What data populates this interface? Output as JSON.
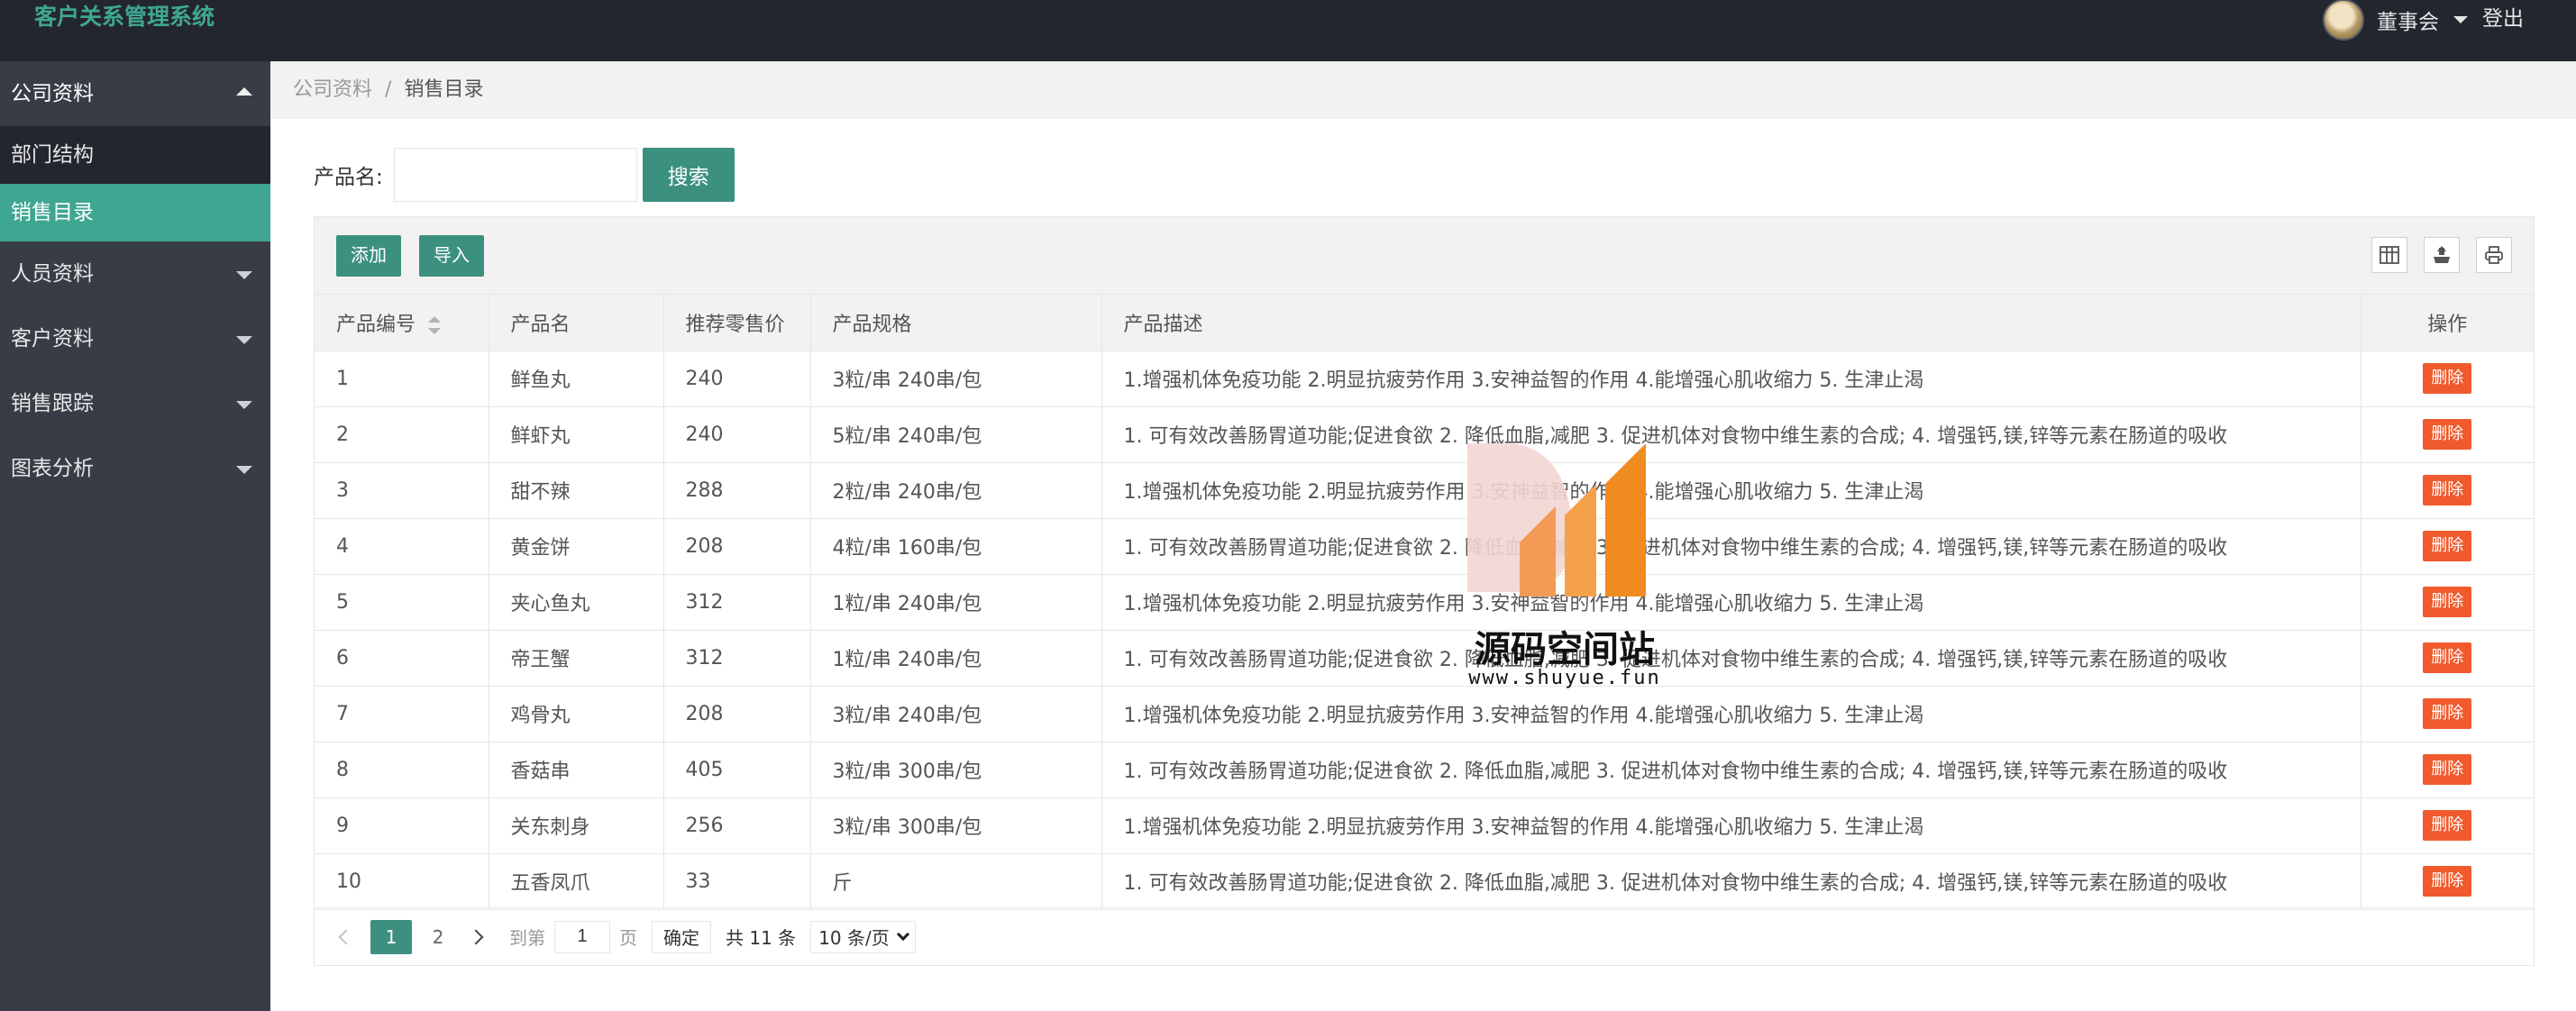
{
  "app": {
    "title": "客户关系管理系统"
  },
  "header": {
    "user_name": "董事会",
    "logout": "登出"
  },
  "sidebar": {
    "items": [
      {
        "label": "公司资料",
        "open": true,
        "children": [
          {
            "label": "部门结构"
          },
          {
            "label": "销售目录",
            "active": true
          }
        ]
      },
      {
        "label": "人员资料"
      },
      {
        "label": "客户资料"
      },
      {
        "label": "销售跟踪"
      },
      {
        "label": "图表分析"
      }
    ]
  },
  "breadcrumb": {
    "parent": "公司资料",
    "separator": "/",
    "current": "销售目录"
  },
  "search": {
    "label": "产品名:",
    "value": "",
    "placeholder": "",
    "button": "搜索"
  },
  "toolbar": {
    "add": "添加",
    "import": "导入"
  },
  "table": {
    "columns": [
      "产品编号",
      "产品名",
      "推荐零售价",
      "产品规格",
      "产品描述",
      "操作"
    ],
    "delete_label": "删除",
    "rows": [
      {
        "id": "1",
        "name": "鲜鱼丸",
        "price": "240",
        "spec": "3粒/串 240串/包",
        "desc": "1.增强机体免疫功能 2.明显抗疲劳作用 3.安神益智的作用 4.能增强心肌收缩力 5. 生津止渴"
      },
      {
        "id": "2",
        "name": "鲜虾丸",
        "price": "240",
        "spec": "5粒/串 240串/包",
        "desc": "1. 可有效改善肠胃道功能;促进食欲 2. 降低血脂,减肥 3. 促进机体对食物中维生素的合成; 4. 增强钙,镁,锌等元素在肠道的吸收"
      },
      {
        "id": "3",
        "name": "甜不辣",
        "price": "288",
        "spec": "2粒/串 240串/包",
        "desc": "1.增强机体免疫功能 2.明显抗疲劳作用 3.安神益智的作用 4.能增强心肌收缩力 5. 生津止渴"
      },
      {
        "id": "4",
        "name": "黄金饼",
        "price": "208",
        "spec": "4粒/串 160串/包",
        "desc": "1. 可有效改善肠胃道功能;促进食欲 2. 降低血脂,减肥 3. 促进机体对食物中维生素的合成; 4. 增强钙,镁,锌等元素在肠道的吸收"
      },
      {
        "id": "5",
        "name": "夹心鱼丸",
        "price": "312",
        "spec": "1粒/串 240串/包",
        "desc": "1.增强机体免疫功能 2.明显抗疲劳作用 3.安神益智的作用 4.能增强心肌收缩力 5. 生津止渴"
      },
      {
        "id": "6",
        "name": "帝王蟹",
        "price": "312",
        "spec": "1粒/串 240串/包",
        "desc": "1. 可有效改善肠胃道功能;促进食欲 2. 降低血脂,减肥 3. 促进机体对食物中维生素的合成; 4. 增强钙,镁,锌等元素在肠道的吸收"
      },
      {
        "id": "7",
        "name": "鸡骨丸",
        "price": "208",
        "spec": "3粒/串 240串/包",
        "desc": "1.增强机体免疫功能 2.明显抗疲劳作用 3.安神益智的作用 4.能增强心肌收缩力 5. 生津止渴"
      },
      {
        "id": "8",
        "name": "香菇串",
        "price": "405",
        "spec": "3粒/串 300串/包",
        "desc": "1. 可有效改善肠胃道功能;促进食欲 2. 降低血脂,减肥 3. 促进机体对食物中维生素的合成; 4. 增强钙,镁,锌等元素在肠道的吸收"
      },
      {
        "id": "9",
        "name": "关东刺身",
        "price": "256",
        "spec": "3粒/串 300串/包",
        "desc": "1.增强机体免疫功能 2.明显抗疲劳作用 3.安神益智的作用 4.能增强心肌收缩力 5. 生津止渴"
      },
      {
        "id": "10",
        "name": "五香凤爪",
        "price": "33",
        "spec": "斤",
        "desc": "1. 可有效改善肠胃道功能;促进食欲 2. 降低血脂,减肥 3. 促进机体对食物中维生素的合成; 4. 增强钙,镁,锌等元素在肠道的吸收"
      }
    ]
  },
  "pagination": {
    "pages": [
      "1",
      "2"
    ],
    "current": "1",
    "goto_prefix": "到第",
    "goto_value": "1",
    "goto_suffix": "页",
    "confirm": "确定",
    "total": "共 11 条",
    "page_size": "10 条/页"
  },
  "watermark": {
    "text": "源码空间站",
    "url": "www.shuyue.fun"
  },
  "colors": {
    "header_bg": "#23262e",
    "sidebar_bg": "#383c46",
    "accent": "#3c9080",
    "brand": "#3fa691",
    "danger": "#f05a2c"
  },
  "icons": {
    "toolbar": [
      "columns-icon",
      "export-icon",
      "print-icon"
    ]
  }
}
